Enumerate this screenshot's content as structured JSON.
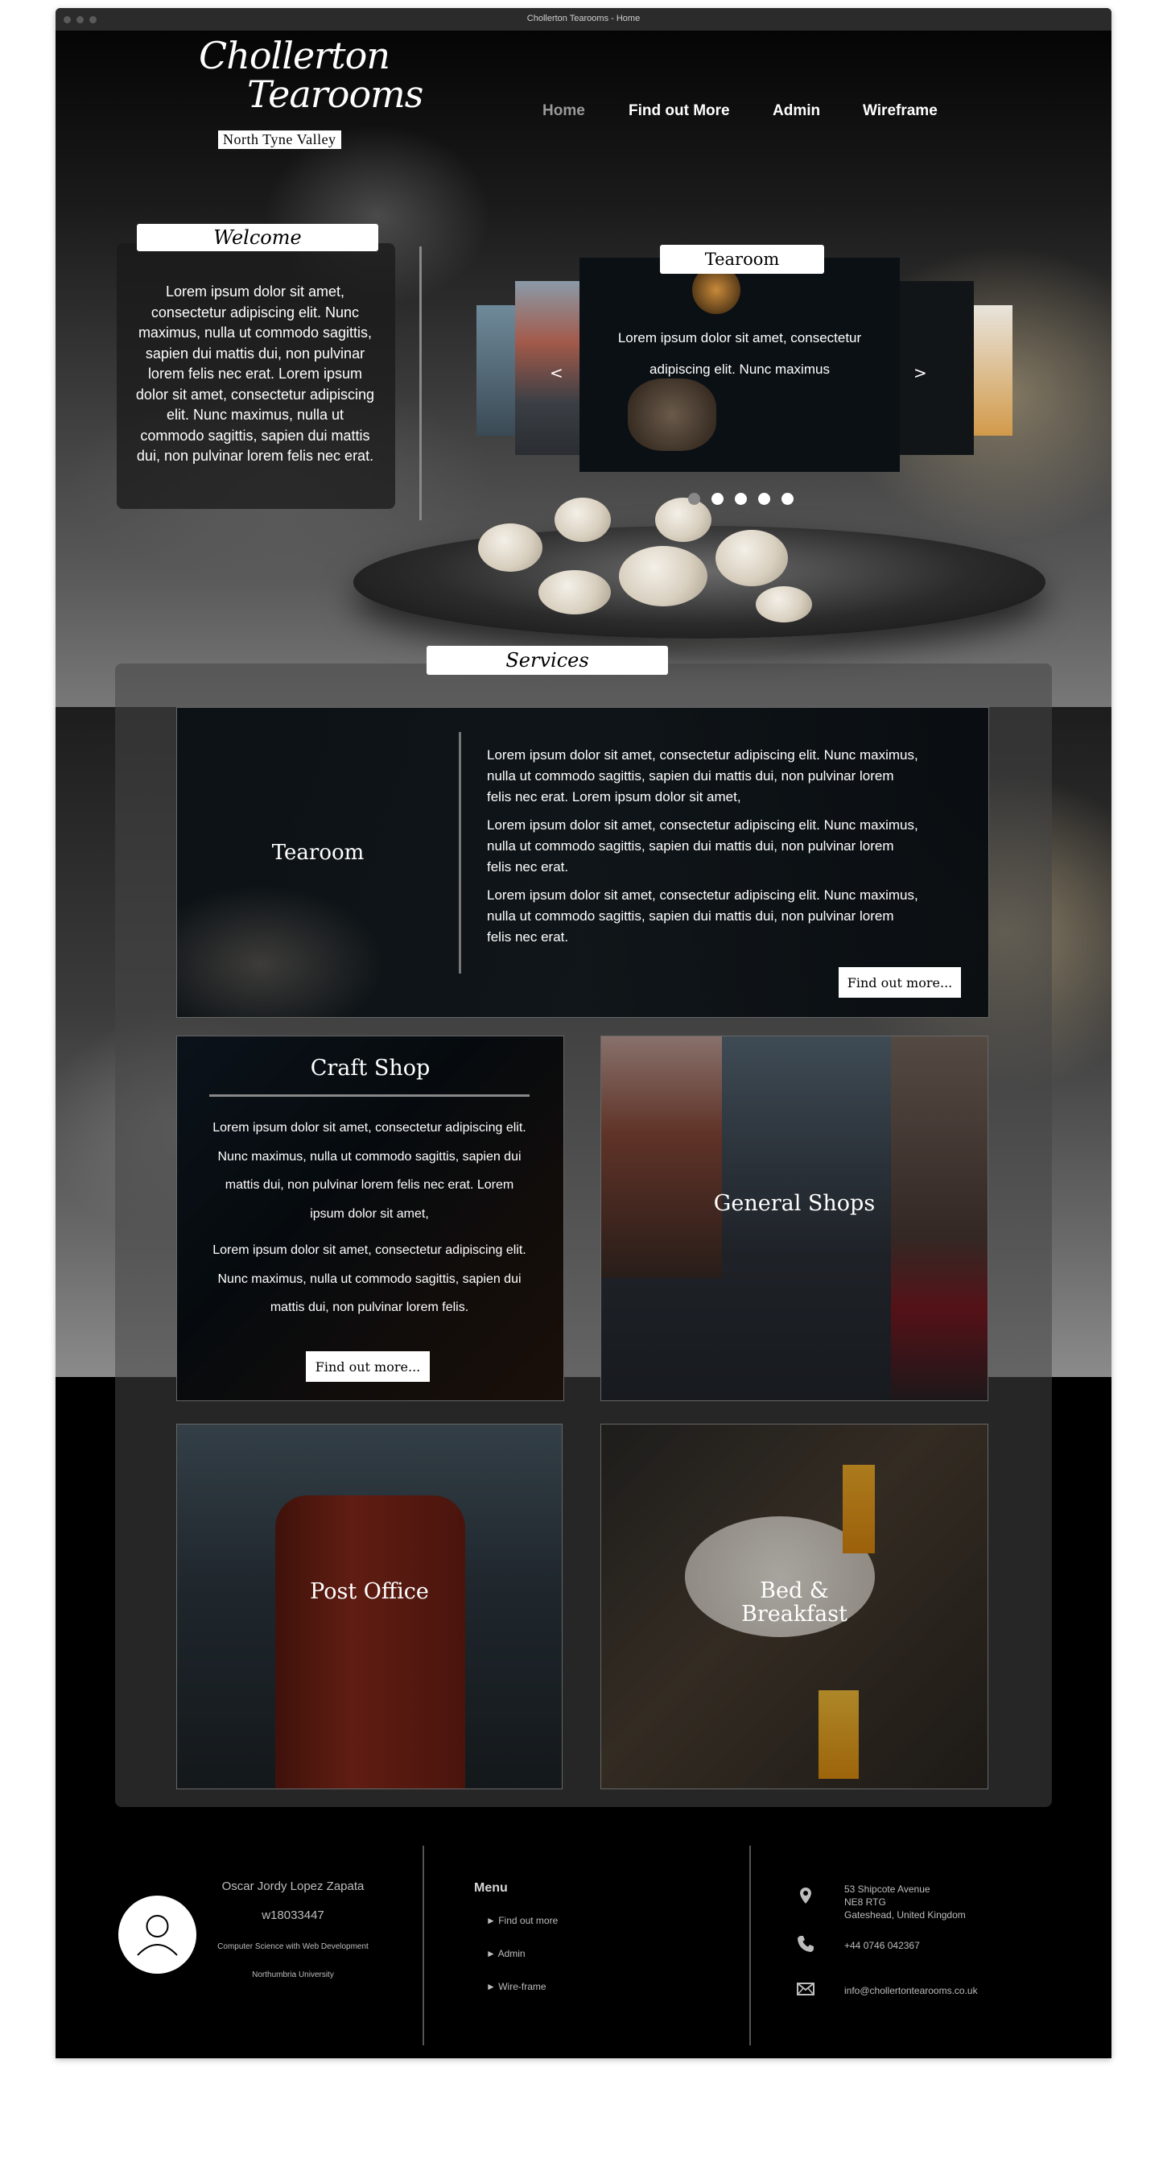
{
  "window": {
    "title": "Chollerton Tearooms - Home"
  },
  "logo": {
    "line1": "Chollerton",
    "line2": "Tearooms",
    "tagline": "North Tyne Valley"
  },
  "nav": {
    "items": [
      "Home",
      "Find out More",
      "Admin",
      "Wireframe"
    ],
    "active": "Home"
  },
  "welcome": {
    "title": "Welcome",
    "text": "Lorem ipsum dolor sit amet, consectetur adipiscing elit. Nunc maximus, nulla ut commodo sagittis, sapien dui mattis dui, non pulvinar lorem felis nec erat. Lorem ipsum dolor sit amet, consectetur adipiscing elit. Nunc maximus, nulla ut commodo sagittis, sapien dui mattis dui, non pulvinar lorem felis nec erat."
  },
  "carousel": {
    "title": "Tearoom",
    "text": "Lorem ipsum dolor sit amet, consectetur adipiscing elit. Nunc maximus",
    "prev": "<",
    "next": ">",
    "slides_count": 5,
    "active_slide": 1
  },
  "services": {
    "title": "Services",
    "tearoom": {
      "title": "Tearoom",
      "paragraphs": [
        "Lorem ipsum dolor sit amet, consectetur adipiscing elit. Nunc maximus, nulla ut commodo sagittis, sapien dui mattis dui, non pulvinar lorem felis nec erat. Lorem ipsum dolor sit amet,",
        "Lorem ipsum dolor sit amet, consectetur adipiscing elit. Nunc maximus, nulla ut commodo sagittis, sapien dui mattis dui, non pulvinar lorem felis nec erat.",
        "Lorem ipsum dolor sit amet, consectetur adipiscing elit. Nunc maximus, nulla ut commodo sagittis, sapien dui mattis dui, non pulvinar lorem felis nec erat."
      ],
      "button": "Find out more..."
    },
    "craft_shop": {
      "title": "Craft Shop",
      "paragraphs": [
        "Lorem ipsum dolor sit amet, consectetur adipiscing elit. Nunc maximus, nulla ut commodo sagittis, sapien dui mattis dui, non pulvinar lorem felis nec erat. Lorem ipsum dolor sit amet,",
        "Lorem ipsum dolor sit amet, consectetur adipiscing elit. Nunc maximus, nulla ut commodo sagittis, sapien dui mattis dui, non pulvinar lorem felis."
      ],
      "button": "Find out more..."
    },
    "general_shops": {
      "title": "General Shops"
    },
    "post_office": {
      "title": "Post Office"
    },
    "bed_breakfast": {
      "title_line1": "Bed &",
      "title_line2": "Breakfast"
    }
  },
  "footer": {
    "name": "Oscar Jordy Lopez Zapata",
    "student_id": "w18033447",
    "course": "Computer Science with Web Development",
    "university": "Northumbria University",
    "menu_title": "Menu",
    "menu_items": [
      "Find out more",
      "Admin",
      "Wire-frame"
    ],
    "address_line1": "53 Shipcote Avenue",
    "address_line2": "NE8 RTG",
    "address_line3": "Gateshead, United Kingdom",
    "phone": "+44 0746 042367",
    "email": "info@chollertontearooms.co.uk"
  },
  "colors": {
    "background": "#000000",
    "accent": "#ffffff",
    "nav_active": "#9a9a9a"
  },
  "icons": [
    "location-pin-icon",
    "phone-icon",
    "envelope-icon",
    "user-avatar-icon"
  ]
}
